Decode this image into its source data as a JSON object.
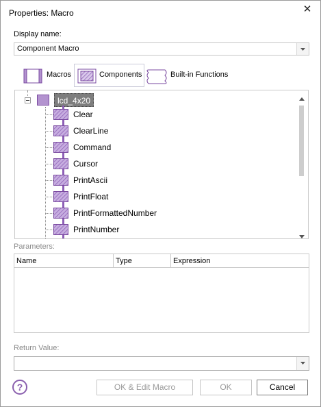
{
  "window": {
    "title": "Properties: Macro",
    "close_glyph": "✕"
  },
  "display_name": {
    "label": "Display name:",
    "value": "Component Macro"
  },
  "tabs": [
    {
      "label": "Macros",
      "icon": "macro-icon",
      "active": false
    },
    {
      "label": "Components",
      "icon": "component-icon",
      "active": true
    },
    {
      "label": "Built-in Functions",
      "icon": "builtin-function-icon",
      "active": false
    }
  ],
  "tree": {
    "root": {
      "label": "lcd_4x20",
      "expander": "−"
    },
    "items": [
      "Clear",
      "ClearLine",
      "Command",
      "Cursor",
      "PrintAscii",
      "PrintFloat",
      "PrintFormattedNumber",
      "PrintNumber"
    ]
  },
  "parameters": {
    "label": "Parameters:",
    "columns": [
      "Name",
      "Type",
      "Expression"
    ]
  },
  "return_value": {
    "label": "Return Value:",
    "value": ""
  },
  "buttons": {
    "help": "?",
    "ok_edit": "OK & Edit Macro",
    "ok": "OK",
    "cancel": "Cancel"
  },
  "colors": {
    "accent": "#8e5fb7",
    "selected_bg": "#7e7e7e"
  }
}
